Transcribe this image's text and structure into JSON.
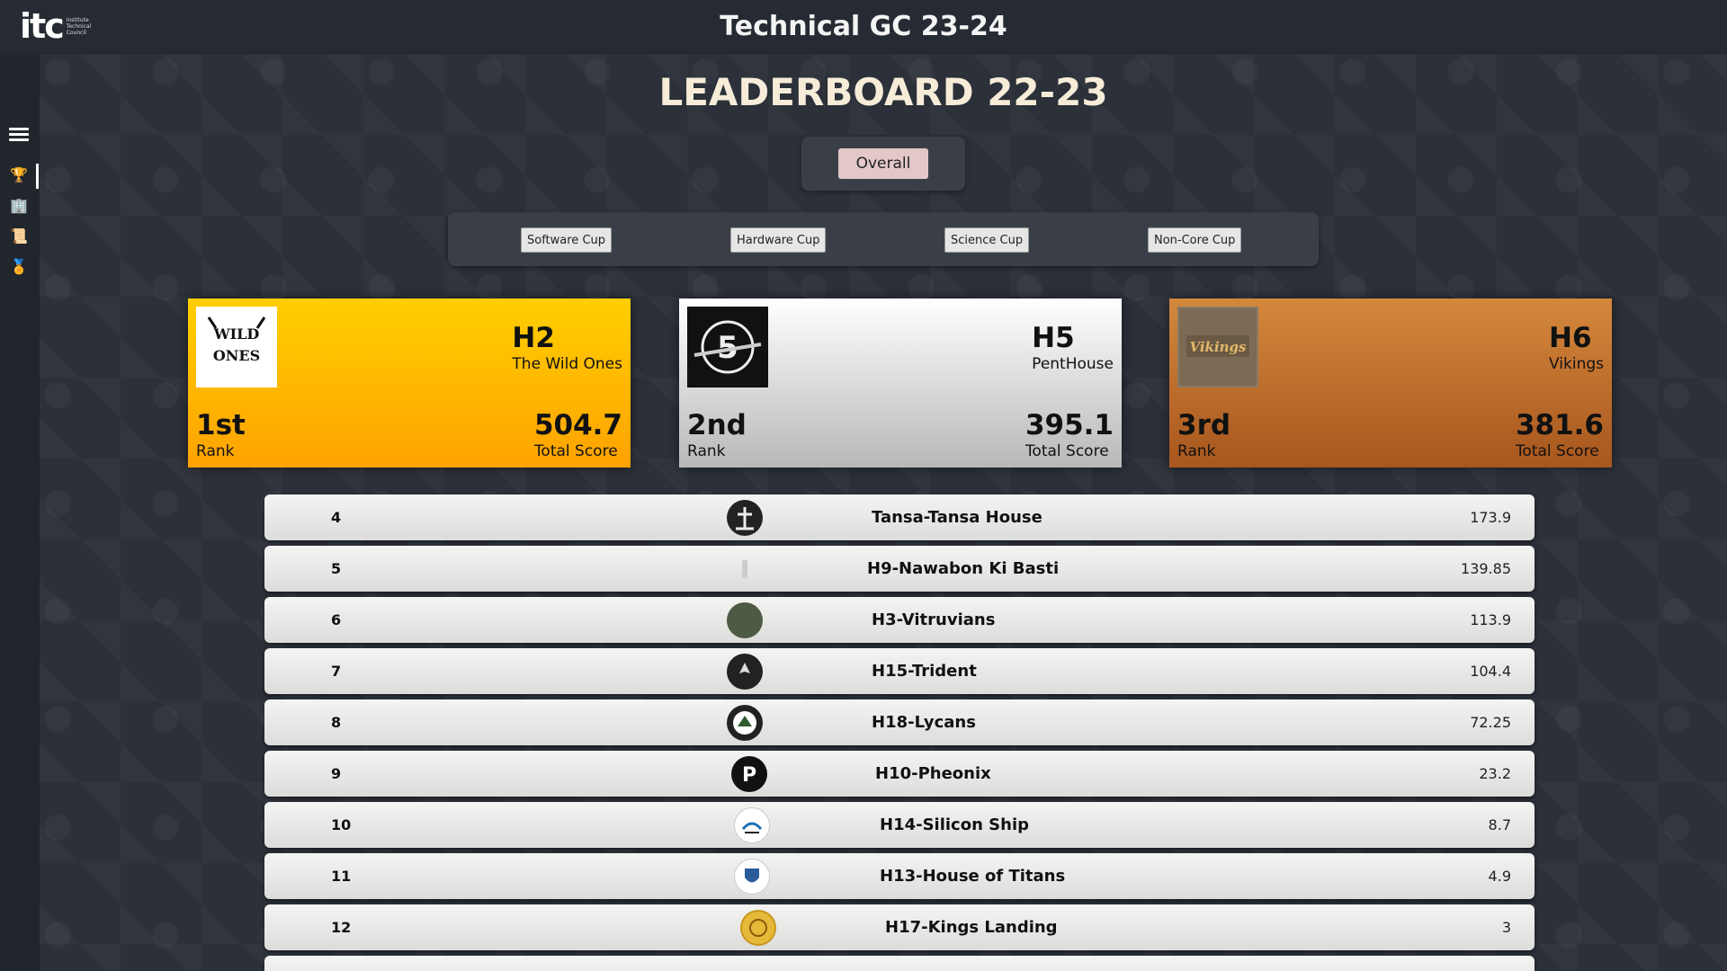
{
  "header": {
    "title": "Technical GC 23-24",
    "logo_mark": "itc",
    "logo_sub": "Institute Technical Council"
  },
  "sidebar": {
    "items": [
      {
        "icon": "trophy-icon",
        "glyph": "🏆"
      },
      {
        "icon": "building-icon",
        "glyph": "🏢"
      },
      {
        "icon": "scroll-icon",
        "glyph": "📜"
      },
      {
        "icon": "medal-icon",
        "glyph": "🏅"
      }
    ]
  },
  "main": {
    "heading": "LEADERBOARD 22-23",
    "overall_label": "Overall",
    "cups": [
      "Software Cup",
      "Hardware Cup",
      "Science Cup",
      "Non-Core Cup"
    ]
  },
  "podium": [
    {
      "code": "H2",
      "name": "The Wild Ones",
      "rank": "1st",
      "rank_label": "Rank",
      "score": "504.7",
      "score_label": "Total Score",
      "logo_text": "THE WILD ONES"
    },
    {
      "code": "H5",
      "name": "PentHouse",
      "rank": "2nd",
      "rank_label": "Rank",
      "score": "395.1",
      "score_label": "Total Score",
      "logo_text": "5"
    },
    {
      "code": "H6",
      "name": "Vikings",
      "rank": "3rd",
      "rank_label": "Rank",
      "score": "381.6",
      "score_label": "Total Score",
      "logo_text": "Vikings"
    }
  ],
  "rows": [
    {
      "rank": "4",
      "name": "Tansa-Tansa House",
      "score": "173.9"
    },
    {
      "rank": "5",
      "name": "H9-Nawabon Ki Basti",
      "score": "139.85"
    },
    {
      "rank": "6",
      "name": "H3-Vitruvians",
      "score": "113.9"
    },
    {
      "rank": "7",
      "name": "H15-Trident",
      "score": "104.4"
    },
    {
      "rank": "8",
      "name": "H18-Lycans",
      "score": "72.25"
    },
    {
      "rank": "9",
      "name": "H10-Pheonix",
      "score": "23.2"
    },
    {
      "rank": "10",
      "name": "H14-Silicon Ship",
      "score": "8.7"
    },
    {
      "rank": "11",
      "name": "H13-House of Titans",
      "score": "4.9"
    },
    {
      "rank": "12",
      "name": "H17-Kings Landing",
      "score": "3"
    }
  ]
}
